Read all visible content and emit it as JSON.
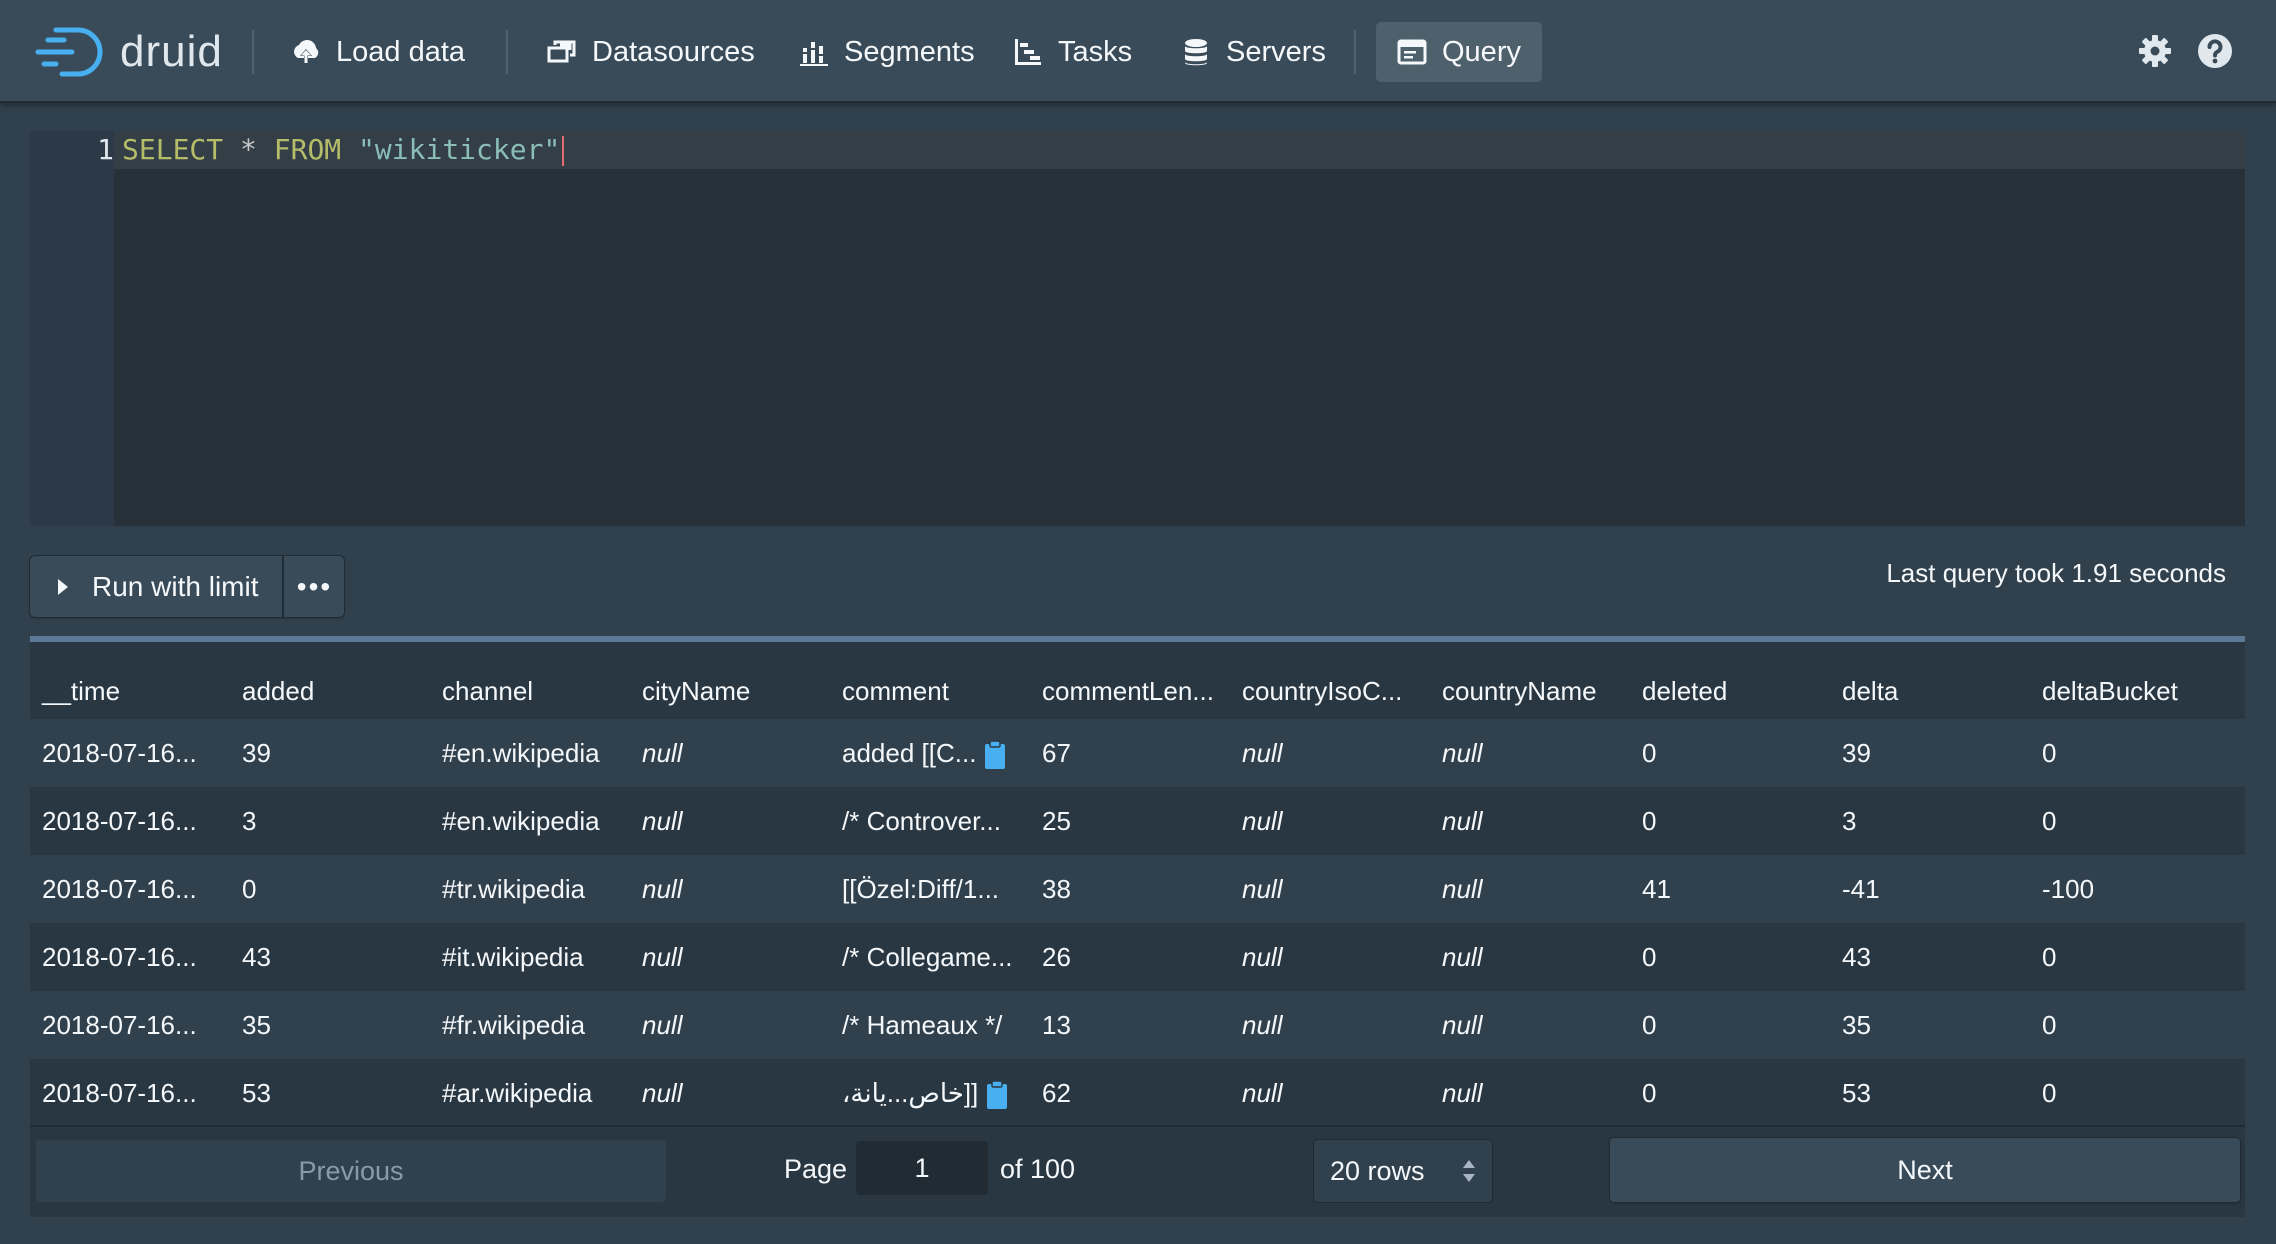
{
  "app": {
    "brand": "druid"
  },
  "nav": {
    "items": [
      {
        "label": "Load data",
        "icon": "cloud-upload-icon"
      },
      {
        "label": "Datasources",
        "icon": "multi-select-icon"
      },
      {
        "label": "Segments",
        "icon": "stacked-chart-icon"
      },
      {
        "label": "Tasks",
        "icon": "gantt-chart-icon"
      },
      {
        "label": "Servers",
        "icon": "database-icon"
      },
      {
        "label": "Query",
        "icon": "application-icon",
        "active": true
      }
    ],
    "right_icons": [
      "cog-icon",
      "help-icon"
    ]
  },
  "editor": {
    "line_number": "1",
    "tokens": {
      "kw1": "SELECT",
      "op": "*",
      "kw2": "FROM",
      "str": "\"wikiticker\""
    }
  },
  "run": {
    "run_label": "Run with limit",
    "more_label": "•••",
    "timing": "Last query took 1.91 seconds"
  },
  "table": {
    "columns": [
      "__time",
      "added",
      "channel",
      "cityName",
      "comment",
      "commentLen...",
      "countryIsoC...",
      "countryName",
      "deleted",
      "delta",
      "deltaBucket"
    ],
    "rows": [
      [
        "2018-07-16...",
        "39",
        "#en.wikipedia",
        "null",
        "added [[C...",
        "67",
        "null",
        "null",
        "0",
        "39",
        "0"
      ],
      [
        "2018-07-16...",
        "3",
        "#en.wikipedia",
        "null",
        "/* Controver...",
        "25",
        "null",
        "null",
        "0",
        "3",
        "0"
      ],
      [
        "2018-07-16...",
        "0",
        "#tr.wikipedia",
        "null",
        "[[Özel:Diff/1...",
        "38",
        "null",
        "null",
        "41",
        "-41",
        "-100"
      ],
      [
        "2018-07-16...",
        "43",
        "#it.wikipedia",
        "null",
        "/* Collegame...",
        "26",
        "null",
        "null",
        "0",
        "43",
        "0"
      ],
      [
        "2018-07-16...",
        "35",
        "#fr.wikipedia",
        "null",
        "/* Hameaux */",
        "13",
        "null",
        "null",
        "0",
        "35",
        "0"
      ],
      [
        "2018-07-16...",
        "53",
        "#ar.wikipedia",
        "null",
        "[[خاص...يانة،",
        "62",
        "null",
        "null",
        "0",
        "53",
        "0"
      ]
    ],
    "clipboard_rows": [
      0,
      5
    ]
  },
  "pager": {
    "previous": "Previous",
    "page_label": "Page",
    "page_value": "1",
    "of_label": "of 100",
    "rows_value": "20 rows",
    "next": "Next"
  },
  "colors": {
    "navbar": "#394b59",
    "background": "#30404d",
    "keyword": "#b5bd68",
    "string": "#8abeb7",
    "clipboard": "#48aff0"
  }
}
